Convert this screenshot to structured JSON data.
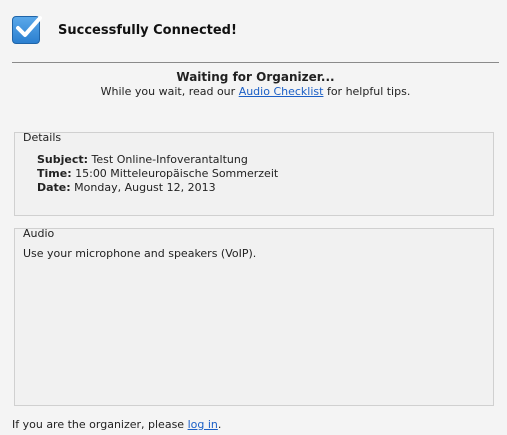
{
  "header": {
    "title": "Successfully Connected!",
    "icon": "checkmark-icon"
  },
  "waiting": {
    "title": "Waiting for Organizer...",
    "prefix": "While you wait, read our ",
    "link": "Audio Checklist",
    "suffix": " for helpful tips."
  },
  "details": {
    "label": "Details",
    "subject_label": "Subject:",
    "subject_value": "Test Online-Infoverantaltung",
    "time_label": "Time:",
    "time_value": "15:00 Mitteleuropäische Sommerzeit",
    "date_label": "Date:",
    "date_value": "Monday, August 12, 2013"
  },
  "audio": {
    "label": "Audio",
    "text": "Use your microphone and speakers (VoIP)."
  },
  "footer": {
    "prefix": "If you are the organizer, please ",
    "link": "log in",
    "suffix": "."
  },
  "colors": {
    "accent": "#2b7fd0",
    "link": "#1b5fc6",
    "background": "#f4f4f4"
  }
}
